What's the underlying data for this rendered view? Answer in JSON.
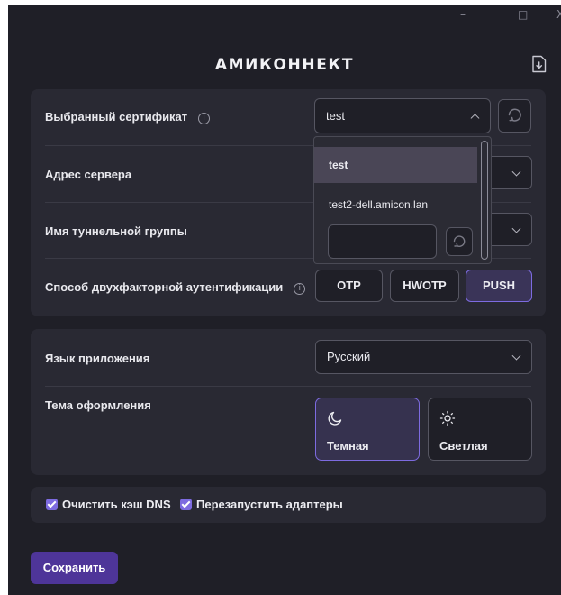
{
  "window": {
    "title": "АМИКОННЕКТ",
    "controls": {
      "minimize": "–",
      "maximize": "□",
      "close": "X"
    },
    "export_icon": "file-download-icon"
  },
  "connection": {
    "certificate": {
      "label": "Выбранный сертификат",
      "value": "test",
      "info_icon": "info-icon",
      "refresh_icon": "refresh-icon"
    },
    "server": {
      "label": "Адрес сервера",
      "value": ""
    },
    "tunnel_group": {
      "label": "Имя туннельной группы",
      "value": ""
    },
    "two_factor": {
      "label": "Способ двухфакторной аутентификации",
      "info_icon": "info-icon",
      "options": [
        "OTP",
        "HWOTP",
        "PUSH"
      ],
      "selected": "PUSH"
    }
  },
  "certificate_dropdown": {
    "items": [
      "test",
      "test2-dell.amicon.lan"
    ],
    "selected": "test",
    "input_value": ""
  },
  "appearance": {
    "language": {
      "label": "Язык приложения",
      "value": "Русский"
    },
    "theme": {
      "label": "Тема оформления",
      "options": [
        {
          "label": "Темная",
          "icon": "moon-icon"
        },
        {
          "label": "Светлая",
          "icon": "sun-icon"
        }
      ],
      "selected": "Темная"
    }
  },
  "options": {
    "flush_dns": {
      "label": "Очистить кэш DNS",
      "checked": true
    },
    "restart_adapters": {
      "label": "Перезапустить адаптеры",
      "checked": true
    }
  },
  "actions": {
    "save": "Сохранить"
  },
  "colors": {
    "background": "#1f1f27",
    "panel": "#292933",
    "accent": "#7d6be0",
    "save": "#4e3599"
  }
}
